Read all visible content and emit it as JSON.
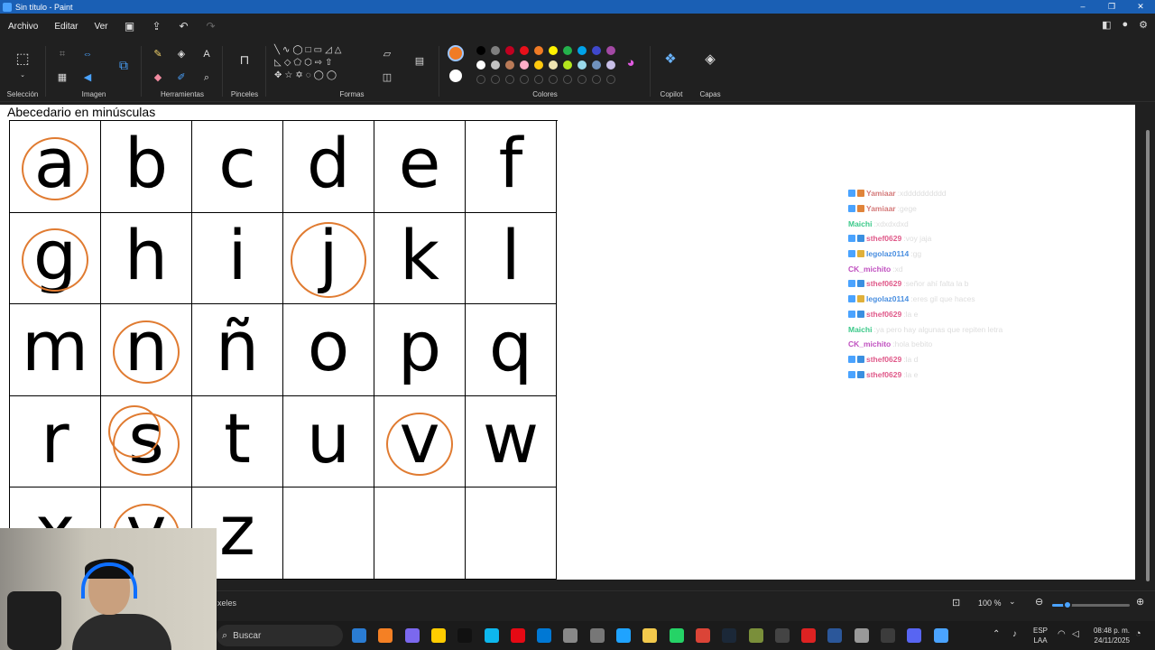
{
  "window": {
    "title": "Sin título - Paint",
    "controls": [
      "–",
      "❐",
      "✕"
    ]
  },
  "menu": {
    "items": [
      "Archivo",
      "Editar",
      "Ver"
    ],
    "quick": [
      "save-icon",
      "share-icon",
      "undo-icon",
      "redo-icon"
    ]
  },
  "ribbon": {
    "groups": {
      "seleccion": "Selección",
      "imagen": "Imagen",
      "herramientas": "Herramientas",
      "pinceles": "Pinceles",
      "formas": "Formas",
      "colores": "Colores",
      "copilot": "Copilot",
      "capas": "Capas"
    },
    "active_color": "#f07b25",
    "secondary_color": "#ffffff",
    "palette_row1": [
      "#000000",
      "#7f7f7f",
      "#c00020",
      "#e8101a",
      "#f07b25",
      "#fff200",
      "#24b14c",
      "#00a2e8",
      "#3f48cc",
      "#a349a4"
    ],
    "palette_row2": [
      "#ffffff",
      "#c3c3c3",
      "#b97a57",
      "#ffaec9",
      "#ffc90e",
      "#efe4b0",
      "#b5e61d",
      "#99d9ea",
      "#7092be",
      "#c8bfe7"
    ]
  },
  "canvas": {
    "heading": "Abecedario en minúsculas",
    "letters": [
      "a",
      "b",
      "c",
      "d",
      "e",
      "f",
      "g",
      "h",
      "i",
      "j",
      "k",
      "l",
      "m",
      "n",
      "ñ",
      "o",
      "p",
      "q",
      "r",
      "s",
      "t",
      "u",
      "v",
      "w",
      "x",
      "y",
      "z",
      "",
      "",
      ""
    ],
    "circled": [
      "a",
      "g",
      "j",
      "n",
      "s",
      "v",
      "y"
    ],
    "ring_color": "#e07b31"
  },
  "chat": [
    {
      "user": "Yamiaar",
      "msg": "xdddddddddd",
      "color": "#d47a7a",
      "badges": [
        "#4aa3ff",
        "#e0843a"
      ]
    },
    {
      "user": "Yamiaar",
      "msg": "gege",
      "color": "#d47a7a",
      "badges": [
        "#4aa3ff",
        "#e0843a"
      ]
    },
    {
      "user": "Maichi",
      "msg": "xdxdxdxd",
      "color": "#3cc98a",
      "badges": []
    },
    {
      "user": "sthef0629",
      "msg": "voy jaja",
      "color": "#e05a8a",
      "badges": [
        "#4aa3ff",
        "#3a8fe0"
      ]
    },
    {
      "user": "legolaz0114",
      "msg": "gg",
      "color": "#4a8fe0",
      "badges": [
        "#4aa3ff",
        "#e0b03a"
      ]
    },
    {
      "user": "CK_michito",
      "msg": "xd",
      "color": "#c050c0",
      "badges": []
    },
    {
      "user": "sthef0629",
      "msg": "señor ahí falta la b",
      "color": "#e05a8a",
      "badges": [
        "#4aa3ff",
        "#3a8fe0"
      ]
    },
    {
      "user": "legolaz0114",
      "msg": "eres gil que haces",
      "color": "#4a8fe0",
      "badges": [
        "#4aa3ff",
        "#e0b03a"
      ]
    },
    {
      "user": "sthef0629",
      "msg": "la e",
      "color": "#e05a8a",
      "badges": [
        "#4aa3ff",
        "#3a8fe0"
      ]
    },
    {
      "user": "Maichi",
      "msg": "ya pero hay algunas que repiten letra",
      "color": "#3cc98a",
      "badges": []
    },
    {
      "user": "CK_michito",
      "msg": "hola bebito",
      "color": "#c050c0",
      "badges": []
    },
    {
      "user": "sthef0629",
      "msg": "la d",
      "color": "#e05a8a",
      "badges": [
        "#4aa3ff",
        "#3a8fe0"
      ]
    },
    {
      "user": "sthef0629",
      "msg": "la e",
      "color": "#e05a8a",
      "badges": [
        "#4aa3ff",
        "#3a8fe0"
      ]
    }
  ],
  "status": {
    "pixels": "xeles",
    "zoom": "100 %",
    "zoom_fraction": 0.2
  },
  "taskbar": {
    "search_placeholder": "Buscar",
    "lang1": "ESP",
    "lang2": "LAA",
    "time": "08:48 p. m.",
    "date": "24/11/2025",
    "apps": [
      "#2a7cd3",
      "#f48024",
      "#7b68ee",
      "#ffcc00",
      "#111111",
      "#0db7ed",
      "#e50914",
      "#0078d4",
      "#888888",
      "#777777",
      "#1fa3ff",
      "#f2c94c",
      "#25d366",
      "#db4437",
      "#1b2838",
      "#7a8f3a",
      "#444444",
      "#d22",
      "#2b579a",
      "#999999",
      "#3c3c3c",
      "#5865f2",
      "#4aa3ff"
    ]
  }
}
